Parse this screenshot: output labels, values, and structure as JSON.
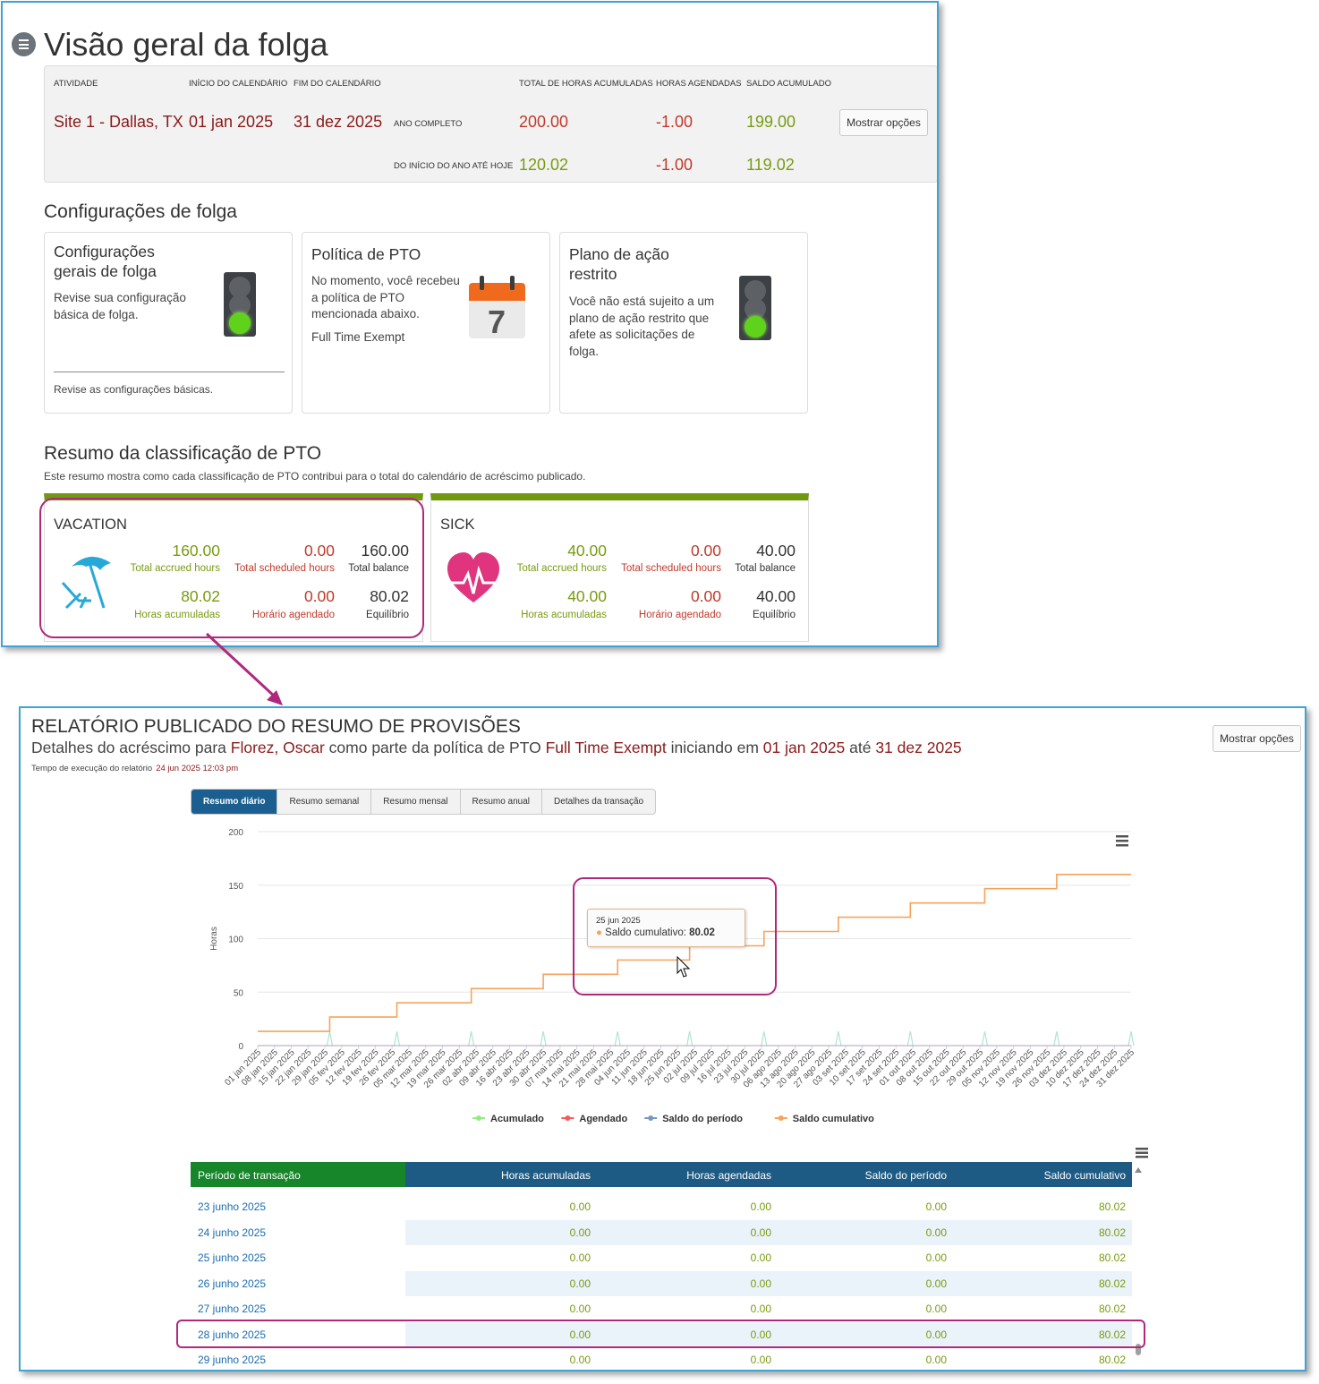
{
  "overview": {
    "title": "Visão geral da folga",
    "headers": {
      "activity": "ATIVIDADE",
      "calendar_start": "INÍCIO DO CALENDÁRIO",
      "calendar_end": "FIM DO CALENDÁRIO",
      "total_accrued": "TOTAL DE HORAS ACUMULADAS",
      "scheduled": "HORAS AGENDADAS",
      "balance": "SALDO ACUMULADO"
    },
    "activity": "Site 1 - Dallas, TX",
    "start": "01 jan 2025",
    "end": "31 dez 2025",
    "full_year_label": "ANO COMPLETO",
    "ytd_label": "DO INÍCIO DO ANO ATÉ HOJE",
    "full_year": {
      "accrued": "200.00",
      "scheduled": "-1.00",
      "balance": "199.00"
    },
    "ytd": {
      "accrued": "120.02",
      "scheduled": "-1.00",
      "balance": "119.02"
    },
    "options_button": "Mostrar opções"
  },
  "settings": {
    "title": "Configurações de folga",
    "cards": [
      {
        "title": "Configurações gerais de folga",
        "text": "Revise sua configuração básica de folga.",
        "link": "Revise as configurações básicas.",
        "icon": "traffic-light-green-icon"
      },
      {
        "title": "Política de PTO",
        "text": "No momento, você recebeu a política de PTO mencionada abaixo.",
        "policy": "Full Time Exempt",
        "icon": "calendar-icon",
        "calendar_day": "7"
      },
      {
        "title": "Plano de ação restrito",
        "text": "Você não está sujeito a um plano de ação restrito que afete as solicitações de folga.",
        "icon": "traffic-light-green-icon"
      }
    ]
  },
  "pto_summary": {
    "title": "Resumo da classificação de PTO",
    "description": "Este resumo mostra como cada classificação de PTO contribui para o total do calendário de acréscimo publicado.",
    "accent_color": "#6f9a10",
    "cards": [
      {
        "name": "VACATION",
        "icon": "beach-umbrella-icon",
        "row1": {
          "accrued": "160.00",
          "accrued_label": "Total accrued hours",
          "scheduled": "0.00",
          "scheduled_label": "Total scheduled hours",
          "balance": "160.00",
          "balance_label": "Total balance"
        },
        "row2": {
          "accrued": "80.02",
          "accrued_label": "Horas acumuladas",
          "scheduled": "0.00",
          "scheduled_label": "Horário agendado",
          "balance": "80.02",
          "balance_label": "Equilíbrio"
        }
      },
      {
        "name": "SICK",
        "icon": "heart-pulse-icon",
        "row1": {
          "accrued": "40.00",
          "accrued_label": "Total accrued hours",
          "scheduled": "0.00",
          "scheduled_label": "Total scheduled hours",
          "balance": "40.00",
          "balance_label": "Total balance"
        },
        "row2": {
          "accrued": "40.00",
          "accrued_label": "Horas acumuladas",
          "scheduled": "0.00",
          "scheduled_label": "Horário agendado",
          "balance": "40.00",
          "balance_label": "Equilíbrio"
        }
      }
    ]
  },
  "report": {
    "title": "RELATÓRIO PUBLICADO DO RESUMO DE PROVISÕES",
    "subtitle": {
      "p1": "Detalhes do acréscimo para",
      "employee": "Florez, Oscar",
      "p2": "como parte da política de PTO",
      "policy": "Full Time Exempt",
      "p3": "iniciando em",
      "start": "01 jan 2025",
      "p4": "até",
      "end": "31 dez 2025"
    },
    "exec_time_label": "Tempo de execução do relatório",
    "exec_time": "24 jun 2025 12:03 pm",
    "options_button": "Mostrar opções",
    "tabs": [
      "Resumo diário",
      "Resumo semanal",
      "Resumo mensal",
      "Resumo anual",
      "Detalhes da transação"
    ],
    "active_tab": 0,
    "tooltip": {
      "date": "25 jun 2025",
      "label": "Saldo cumulativo:",
      "value": "80.02"
    },
    "table": {
      "headers": [
        "Período de transação",
        "Horas acumuladas",
        "Horas agendadas",
        "Saldo do período",
        "Saldo cumulativo"
      ],
      "rows": [
        [
          "23 junho 2025",
          "0.00",
          "0.00",
          "0.00",
          "80.02"
        ],
        [
          "24 junho 2025",
          "0.00",
          "0.00",
          "0.00",
          "80.02"
        ],
        [
          "25 junho 2025",
          "0.00",
          "0.00",
          "0.00",
          "80.02"
        ],
        [
          "26 junho 2025",
          "0.00",
          "0.00",
          "0.00",
          "80.02"
        ],
        [
          "27 junho 2025",
          "0.00",
          "0.00",
          "0.00",
          "80.02"
        ],
        [
          "28 junho 2025",
          "0.00",
          "0.00",
          "0.00",
          "80.02"
        ],
        [
          "29 junho 2025",
          "0.00",
          "0.00",
          "0.00",
          "80.02"
        ]
      ]
    }
  },
  "chart_data": {
    "type": "line",
    "ylabel": "Horas",
    "ylim": [
      0,
      200
    ],
    "yticks": [
      0,
      50,
      100,
      150,
      200
    ],
    "grid": true,
    "legend_position": "bottom",
    "x": [
      "01 jan 2025",
      "08 jan 2025",
      "15 jan 2025",
      "22 jan 2025",
      "29 jan 2025",
      "05 fev 2025",
      "12 fev 2025",
      "19 fev 2025",
      "26 fev 2025",
      "05 mar 2025",
      "12 mar 2025",
      "19 mar 2025",
      "26 mar 2025",
      "02 abr 2025",
      "09 abr 2025",
      "16 abr 2025",
      "23 abr 2025",
      "30 abr 2025",
      "07 mai 2025",
      "14 mai 2025",
      "21 mai 2025",
      "28 mai 2025",
      "04 jun 2025",
      "11 jun 2025",
      "18 jun 2025",
      "25 jun 2025",
      "02 jul 2025",
      "09 jul 2025",
      "16 jul 2025",
      "23 jul 2025",
      "30 jul 2025",
      "06 ago 2025",
      "13 ago 2025",
      "20 ago 2025",
      "27 ago 2025",
      "03 set 2025",
      "10 set 2025",
      "17 set 2025",
      "24 set 2025",
      "01 out 2025",
      "08 out 2025",
      "15 out 2025",
      "22 out 2025",
      "29 out 2025",
      "05 nov 2025",
      "12 nov 2025",
      "19 nov 2025",
      "26 nov 2025",
      "03 dez 2025",
      "10 dez 2025",
      "17 dez 2025",
      "24 dez 2025",
      "31 dez 2025"
    ],
    "series": [
      {
        "name": "Acumulado",
        "color": "#90ed7d",
        "points": [
          [
            "01 jan 2025",
            0
          ],
          [
            "31 jan 2025",
            13.3
          ],
          [
            "28 fev 2025",
            13.3
          ],
          [
            "31 mar 2025",
            13.3
          ],
          [
            "30 abr 2025",
            13.3
          ],
          [
            "31 mai 2025",
            13.3
          ],
          [
            "30 jun 2025",
            13.3
          ],
          [
            "31 jul 2025",
            13.3
          ],
          [
            "31 ago 2025",
            13.3
          ],
          [
            "30 set 2025",
            13.3
          ],
          [
            "31 out 2025",
            13.3
          ],
          [
            "30 nov 2025",
            13.3
          ],
          [
            "31 dez 2025",
            13.3
          ]
        ]
      },
      {
        "name": "Agendado",
        "color": "#f45b5b",
        "points": [
          [
            "01 jan 2025",
            0
          ],
          [
            "31 dez 2025",
            0
          ]
        ]
      },
      {
        "name": "Saldo do período",
        "color": "#7798bf",
        "points": [
          [
            "01 jan 2025",
            0
          ],
          [
            "31 dez 2025",
            0
          ]
        ]
      },
      {
        "name": "Saldo cumulativo",
        "color": "#f7a35c",
        "points": [
          [
            "01 jan 2025",
            13.3
          ],
          [
            "31 jan 2025",
            26.7
          ],
          [
            "28 fev 2025",
            40
          ],
          [
            "31 mar 2025",
            53.3
          ],
          [
            "30 abr 2025",
            66.7
          ],
          [
            "31 mai 2025",
            80.02
          ],
          [
            "30 jun 2025",
            93.3
          ],
          [
            "31 jul 2025",
            106.7
          ],
          [
            "31 ago 2025",
            120
          ],
          [
            "30 set 2025",
            133.3
          ],
          [
            "31 out 2025",
            146.7
          ],
          [
            "30 nov 2025",
            160
          ],
          [
            "31 dez 2025",
            160
          ]
        ]
      }
    ]
  }
}
